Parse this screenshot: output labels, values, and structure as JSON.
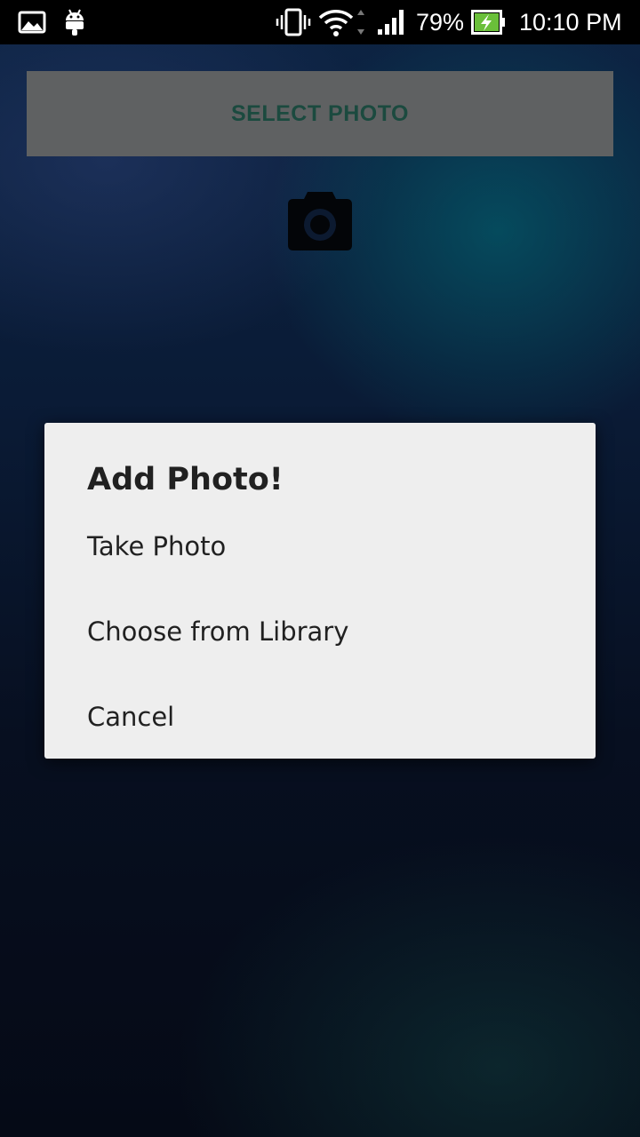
{
  "status_bar": {
    "battery_percent": "79%",
    "time": "10:10 PM",
    "icons": [
      "gallery-icon",
      "android-icon",
      "vibrate-icon",
      "wifi-icon",
      "signal-icon",
      "battery-charging-icon"
    ]
  },
  "main": {
    "select_photo_label": "SELECT PHOTO",
    "camera_icon": "camera-icon"
  },
  "dialog": {
    "title": "Add Photo!",
    "options": [
      {
        "label": "Take Photo"
      },
      {
        "label": "Choose from Library"
      },
      {
        "label": "Cancel"
      }
    ]
  },
  "colors": {
    "status_bar_bg": "#000000",
    "select_button_bg": "#5f6162",
    "select_button_text": "#1b4a3f",
    "dialog_bg": "#eeeeee",
    "dialog_text": "#212121"
  }
}
